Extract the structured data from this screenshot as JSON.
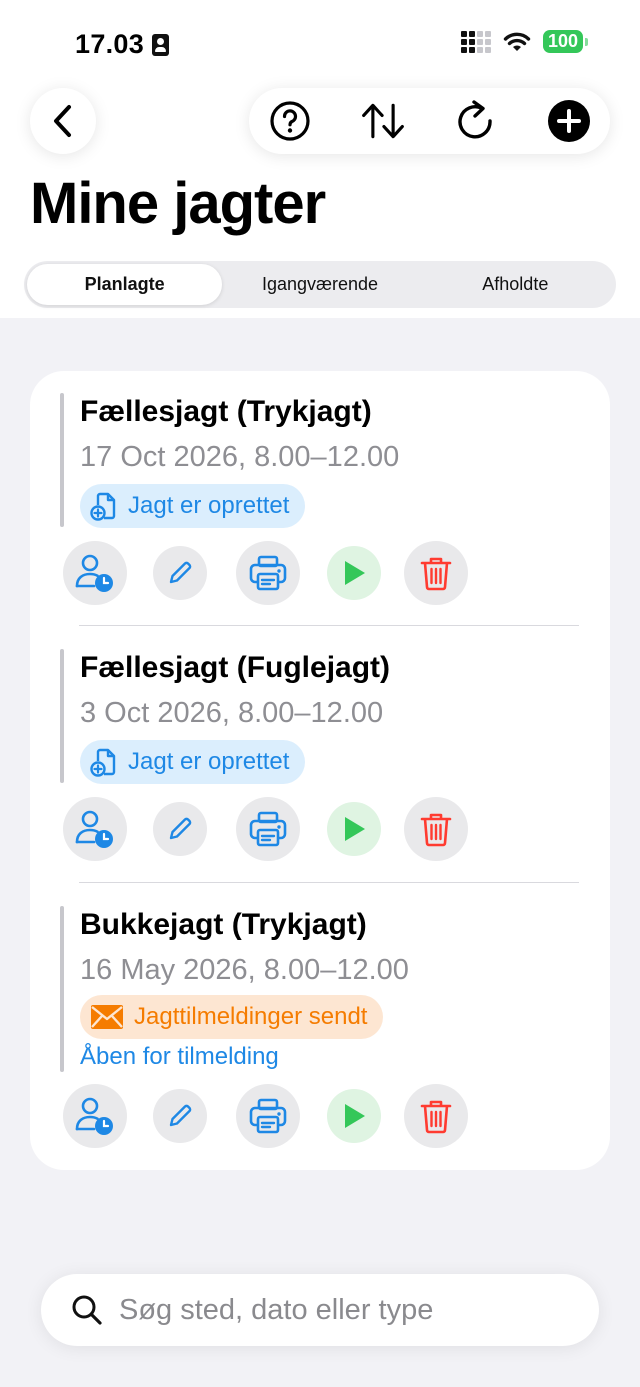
{
  "status": {
    "time": "17.03",
    "battery": "100",
    "colors": {
      "battery": "#34c759"
    }
  },
  "toolbar": {
    "icons": [
      "back-chevron-icon",
      "help-icon",
      "sort-icon",
      "refresh-icon",
      "add-icon"
    ]
  },
  "page": {
    "title": "Mine jagter"
  },
  "tabs": [
    {
      "label": "Planlagte",
      "selected": true
    },
    {
      "label": "Igangværende",
      "selected": false
    },
    {
      "label": "Afholdte",
      "selected": false
    }
  ],
  "hunts": [
    {
      "title": "Fællesjagt (Trykjagt)",
      "date": "17 Oct 2026, 8.00–12.00",
      "status": "Jagt er oprettet",
      "status_color": "#1e88e5"
    },
    {
      "title": "Fællesjagt (Fuglejagt)",
      "date": "3 Oct 2026, 8.00–12.00",
      "status": "Jagt er oprettet",
      "status_color": "#1e88e5"
    },
    {
      "title": "Bukkejagt (Trykjagt)",
      "date": "16 May 2026, 8.00–12.00",
      "status": "Jagttilmeldinger sendt",
      "status_color": "#f57c00",
      "link": "Åben for tilmelding"
    }
  ],
  "search": {
    "placeholder": "Søg sted, dato eller type"
  },
  "colors": {
    "accent": "#1e88e5",
    "play": "#34c759",
    "delete": "#ff3b30"
  }
}
